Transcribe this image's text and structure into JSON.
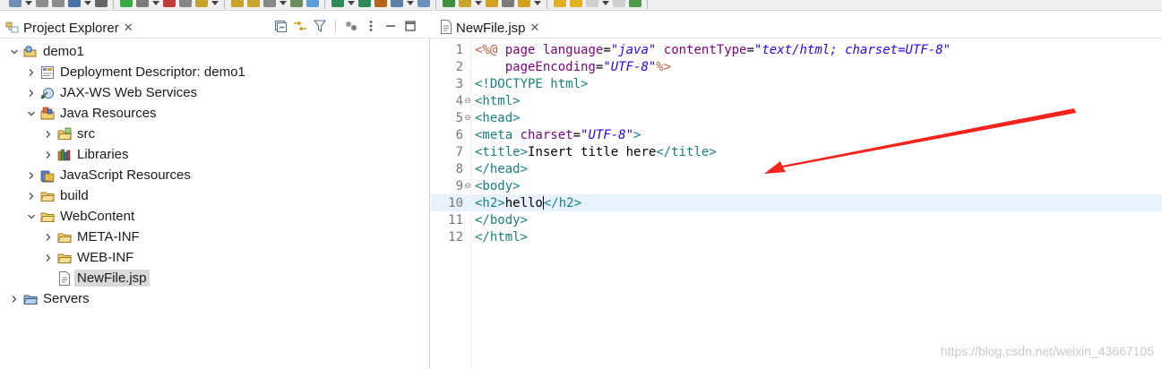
{
  "toolbar": {
    "buttons": [
      "new-icon",
      "save-icon",
      "save-all-icon",
      "print-icon",
      "search-icon",
      "step-icon",
      "pause-icon",
      "terminate-icon",
      "disconnect-icon",
      "step-into-icon",
      "step-over-icon",
      "step-return-icon",
      "drop-to-frame-icon",
      "use-step-filters-icon",
      "skip-breakpoints-icon",
      "debug-icon",
      "run-icon",
      "external-tools-icon",
      "new-server-icon",
      "new-web-project-icon",
      "new-class-icon",
      "open-type-icon",
      "open-task-icon",
      "search-tools-icon",
      "annotation-icon",
      "next-annotation-icon",
      "previous-annotation-icon",
      "back-icon",
      "forward-icon",
      "pin-editor-icon"
    ]
  },
  "explorer": {
    "tab_title": "Project Explorer",
    "close_glyph": "✕",
    "tools": [
      "collapse-all-icon",
      "link-with-editor-icon",
      "filter-icon",
      "focus-icon",
      "view-menu-icon",
      "minimize-icon",
      "maximize-icon"
    ],
    "tree": [
      {
        "label": "demo1",
        "level": 0,
        "expanded": true,
        "icon": "web-project-icon",
        "name": "tree-item-demo1"
      },
      {
        "label": "Deployment Descriptor: demo1",
        "level": 1,
        "expanded": false,
        "icon": "deployment-descriptor-icon",
        "name": "tree-item-deployment-descriptor"
      },
      {
        "label": "JAX-WS Web Services",
        "level": 1,
        "expanded": false,
        "icon": "web-services-icon",
        "name": "tree-item-jax-ws"
      },
      {
        "label": "Java Resources",
        "level": 1,
        "expanded": true,
        "icon": "java-resources-icon",
        "name": "tree-item-java-resources"
      },
      {
        "label": "src",
        "level": 2,
        "expanded": false,
        "icon": "source-folder-icon",
        "name": "tree-item-src"
      },
      {
        "label": "Libraries",
        "level": 2,
        "expanded": false,
        "icon": "libraries-icon",
        "name": "tree-item-libraries"
      },
      {
        "label": "JavaScript Resources",
        "level": 1,
        "expanded": false,
        "icon": "javascript-resources-icon",
        "name": "tree-item-javascript-resources"
      },
      {
        "label": "build",
        "level": 1,
        "expanded": false,
        "icon": "folder-icon",
        "name": "tree-item-build"
      },
      {
        "label": "WebContent",
        "level": 1,
        "expanded": true,
        "icon": "folder-icon",
        "name": "tree-item-webcontent"
      },
      {
        "label": "META-INF",
        "level": 2,
        "expanded": false,
        "icon": "folder-icon",
        "name": "tree-item-meta-inf"
      },
      {
        "label": "WEB-INF",
        "level": 2,
        "expanded": false,
        "icon": "folder-icon",
        "name": "tree-item-web-inf"
      },
      {
        "label": "NewFile.jsp",
        "level": 2,
        "leaf": true,
        "selected": true,
        "icon": "jsp-file-icon",
        "name": "tree-item-newfile-jsp"
      },
      {
        "label": "Servers",
        "level": 0,
        "expanded": false,
        "icon": "servers-folder-icon",
        "name": "tree-item-servers"
      }
    ]
  },
  "editor": {
    "tab_title": "NewFile.jsp",
    "close_glyph": "✕",
    "current_line": 10,
    "lines": [
      {
        "n": "1",
        "fold": "",
        "tokens": [
          [
            "c-dir",
            "<%@ "
          ],
          [
            "c-attr",
            "page "
          ],
          [
            "c-attr",
            "language"
          ],
          [
            "c-text",
            "="
          ],
          [
            "c-val",
            "\"java\""
          ],
          [
            "c-text",
            " "
          ],
          [
            "c-attr",
            "contentType"
          ],
          [
            "c-text",
            "="
          ],
          [
            "c-val",
            "\"text/html; charset=UTF-8\""
          ]
        ]
      },
      {
        "n": "2",
        "fold": "",
        "tokens": [
          [
            "c-text",
            "    "
          ],
          [
            "c-attr",
            "pageEncoding"
          ],
          [
            "c-text",
            "="
          ],
          [
            "c-val",
            "\"UTF-8\""
          ],
          [
            "c-dir",
            "%>"
          ]
        ]
      },
      {
        "n": "3",
        "fold": "",
        "tokens": [
          [
            "c-tag",
            "<!DOCTYPE html>"
          ]
        ]
      },
      {
        "n": "4",
        "fold": "⊖",
        "tokens": [
          [
            "c-tag",
            "<html>"
          ]
        ]
      },
      {
        "n": "5",
        "fold": "⊖",
        "tokens": [
          [
            "c-tag",
            "<head>"
          ]
        ]
      },
      {
        "n": "6",
        "fold": "",
        "tokens": [
          [
            "c-tag",
            "<meta "
          ],
          [
            "c-attr",
            "charset"
          ],
          [
            "c-text",
            "="
          ],
          [
            "c-val",
            "\"UTF-8\""
          ],
          [
            "c-tag",
            ">"
          ]
        ]
      },
      {
        "n": "7",
        "fold": "",
        "tokens": [
          [
            "c-tag",
            "<title>"
          ],
          [
            "c-text",
            "Insert title here"
          ],
          [
            "c-tag",
            "</title>"
          ]
        ]
      },
      {
        "n": "8",
        "fold": "",
        "tokens": [
          [
            "c-tag",
            "</head>"
          ]
        ]
      },
      {
        "n": "9",
        "fold": "⊖",
        "tokens": [
          [
            "c-tag",
            "<body>"
          ]
        ]
      },
      {
        "n": "10",
        "fold": "",
        "tokens": [
          [
            "c-tag",
            "<h2>"
          ],
          [
            "c-text",
            "hello"
          ],
          [
            "caret",
            ""
          ],
          [
            "c-tag",
            "</h2>"
          ]
        ]
      },
      {
        "n": "11",
        "fold": "",
        "tokens": [
          [
            "c-tag",
            "</body>"
          ]
        ]
      },
      {
        "n": "12",
        "fold": "",
        "tokens": [
          [
            "c-tag",
            "</html>"
          ]
        ]
      }
    ]
  },
  "annotation": {
    "color": "#f2241c"
  },
  "watermark": "https://blog.csdn.net/weixin_43667105",
  "colors": {
    "selection": "#d9d9d9",
    "current_line": "#e8f2fe",
    "tag": "#17807e",
    "attribute": "#7f007f",
    "value": "#2a00ff",
    "directive": "#bf5f3f"
  }
}
